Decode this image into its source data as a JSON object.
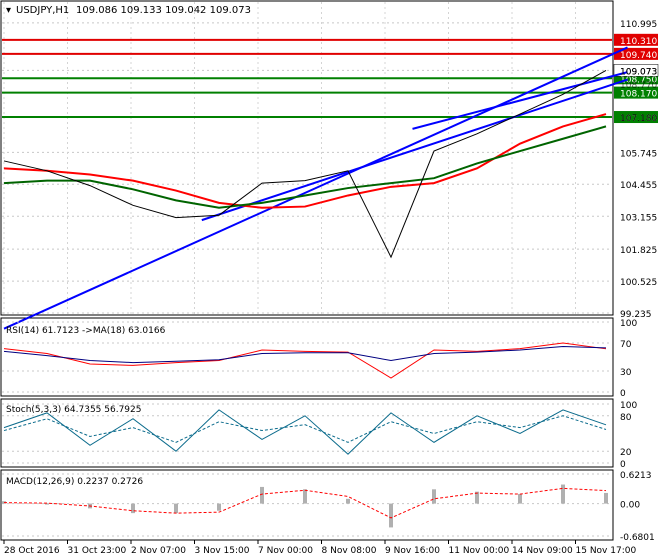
{
  "chart_data": [
    {
      "type": "candlestick",
      "symbol_label": "USDJPY,H1",
      "ohlc_label": "109.086 109.133 109.042 109.073",
      "y_ticks": [
        "110.995",
        "109.073",
        "107.180",
        "105.745",
        "104.455",
        "103.155",
        "101.825",
        "100.525",
        "99.235"
      ],
      "y_tick_values": [
        110.995,
        109.073,
        107.18,
        105.745,
        104.455,
        103.155,
        101.825,
        100.525,
        99.235
      ],
      "ylim": [
        99.235,
        111.6
      ],
      "x_labels": [
        "28 Oct 2016",
        "31 Oct 23:00",
        "2 Nov 07:00",
        "3 Nov 15:00",
        "7 Nov 00:00",
        "8 Nov 08:00",
        "9 Nov 16:00",
        "11 Nov 00:00",
        "14 Nov 09:00",
        "15 Nov 17:00"
      ],
      "current_price": 109.073,
      "current_price_label": "109.073",
      "horizontal_levels": [
        {
          "label": "110.310",
          "value": 110.31,
          "color": "#e00000"
        },
        {
          "label": "109.740",
          "value": 109.74,
          "color": "#e00000"
        },
        {
          "label": "108.750",
          "value": 108.75,
          "color": "#008000"
        },
        {
          "label": "108.170",
          "value": 108.17,
          "color": "#008000"
        },
        {
          "label": "107.180",
          "value": 107.18,
          "color": "#008000"
        }
      ],
      "hidden_level_label": "108.770",
      "series": [
        {
          "name": "MA fast",
          "color": "#ff0000",
          "values": [
            105.1,
            105.0,
            104.85,
            104.6,
            104.2,
            103.7,
            103.5,
            103.55,
            104.0,
            104.35,
            104.5,
            105.1,
            106.1,
            106.8,
            107.3
          ]
        },
        {
          "name": "MA slow",
          "color": "#006400",
          "values": [
            104.5,
            104.6,
            104.6,
            104.25,
            103.8,
            103.5,
            103.7,
            104.0,
            104.3,
            104.5,
            104.7,
            105.3,
            105.8,
            106.3,
            106.8
          ]
        },
        {
          "name": "Price",
          "color": "#000000",
          "values": [
            105.4,
            105.0,
            104.4,
            103.6,
            103.1,
            103.2,
            104.5,
            104.6,
            105.0,
            101.5,
            105.8,
            106.5,
            107.3,
            108.1,
            109.07
          ]
        }
      ],
      "channel_lines": [
        {
          "color": "#0000ff",
          "from": [
            0,
            98.6
          ],
          "to": [
            14.5,
            110.0
          ]
        },
        {
          "color": "#0000ff",
          "from": [
            4.6,
            103.0
          ],
          "to": [
            14.5,
            108.7
          ]
        },
        {
          "color": "#0000ff",
          "from": [
            9.5,
            106.7
          ],
          "to": [
            14.5,
            109.0
          ]
        }
      ]
    },
    {
      "type": "line",
      "title": "RSI(14) 61.7123 ->MA(18) 63.0166",
      "y_ticks": [
        "100",
        "70",
        "30",
        "0"
      ],
      "ylim": [
        0,
        100
      ],
      "series": [
        {
          "name": "RSI",
          "color": "#ff0000",
          "values": [
            62,
            55,
            40,
            38,
            42,
            45,
            60,
            58,
            57,
            20,
            60,
            58,
            62,
            70,
            61.7
          ]
        },
        {
          "name": "MA",
          "color": "#000080",
          "values": [
            58,
            52,
            45,
            42,
            44,
            46,
            55,
            56,
            56,
            45,
            55,
            57,
            60,
            65,
            63.0
          ]
        }
      ]
    },
    {
      "type": "line",
      "title": "Stoch(5,3,3) 64.7355 56.7925",
      "y_ticks": [
        "100",
        "80",
        "20",
        "0"
      ],
      "ylim": [
        0,
        100
      ],
      "series": [
        {
          "name": "%K",
          "color": "#0b6b8c",
          "values": [
            60,
            85,
            30,
            75,
            20,
            90,
            40,
            80,
            15,
            85,
            35,
            80,
            50,
            90,
            64.7
          ]
        },
        {
          "name": "%D",
          "color": "#0b6b8c",
          "values": [
            55,
            75,
            45,
            60,
            35,
            70,
            55,
            65,
            35,
            70,
            50,
            70,
            60,
            80,
            56.8
          ]
        }
      ]
    },
    {
      "type": "bar",
      "title": "MACD(12,26,9) 0.2237 0.2726",
      "y_ticks": [
        "0.6213",
        "0.00",
        "-0.6801"
      ],
      "ylim": [
        -0.6801,
        0.6213
      ],
      "series": [
        {
          "name": "MACD",
          "color": "#b0b0b0",
          "values": [
            0.05,
            0.0,
            -0.1,
            -0.2,
            -0.2,
            -0.15,
            0.35,
            0.3,
            0.1,
            -0.5,
            0.3,
            0.25,
            0.2,
            0.4,
            0.2237
          ]
        },
        {
          "name": "Signal",
          "color": "#ff0000",
          "values": [
            0.02,
            0.01,
            -0.05,
            -0.15,
            -0.2,
            -0.18,
            0.2,
            0.28,
            0.15,
            -0.3,
            0.1,
            0.22,
            0.2,
            0.32,
            0.2726
          ]
        }
      ]
    }
  ]
}
